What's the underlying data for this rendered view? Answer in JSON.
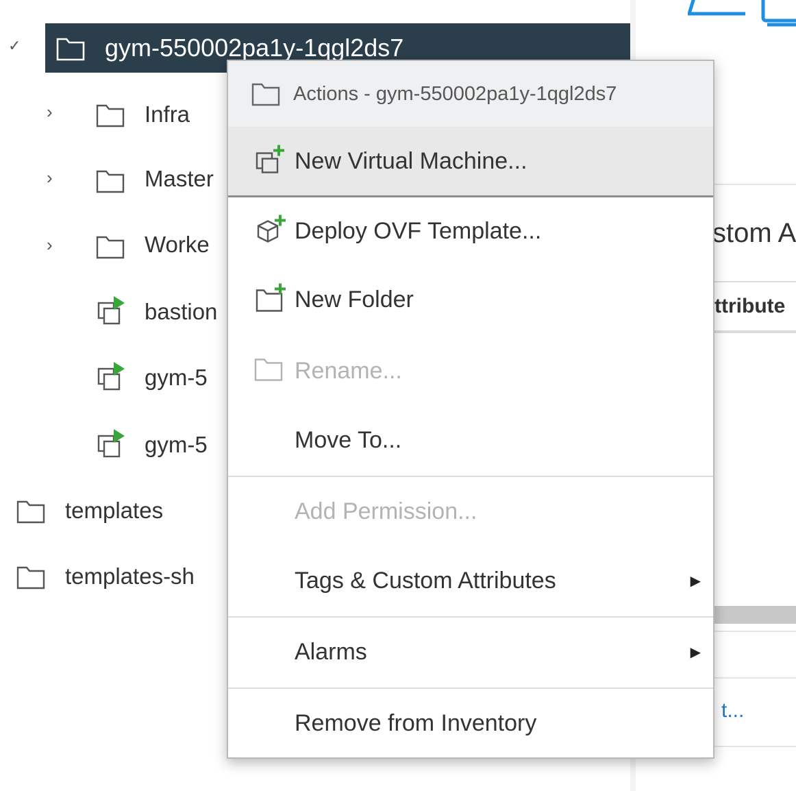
{
  "tree": {
    "root": {
      "label": "gym-550002pa1y-1qgl2ds7",
      "expanded": true
    },
    "children": [
      {
        "label": "Infra",
        "type": "folder"
      },
      {
        "label": "Master",
        "type": "folder"
      },
      {
        "label": "Worke",
        "type": "folder"
      },
      {
        "label": "bastion",
        "type": "vm"
      },
      {
        "label": "gym-5",
        "type": "vm"
      },
      {
        "label": "gym-5",
        "type": "vm"
      }
    ],
    "siblings": [
      {
        "label": "templates"
      },
      {
        "label": "templates-sh"
      }
    ]
  },
  "right_pane": {
    "fragment_heading": "stom A",
    "fragment_column": "ttribute",
    "fragment_link": "t..."
  },
  "context_menu": {
    "header": "Actions - gym-550002pa1y-1qgl2ds7",
    "items": [
      {
        "label": "New Virtual Machine...",
        "enabled": true,
        "hovered": true,
        "icon": "new-vm-icon"
      },
      {
        "label": "Deploy OVF Template...",
        "enabled": true,
        "icon": "deploy-ovf-icon"
      },
      {
        "label": "New Folder",
        "enabled": true,
        "icon": "new-folder-icon"
      },
      {
        "label": "Rename...",
        "enabled": false,
        "icon": "folder-icon"
      },
      {
        "label": "Move To...",
        "enabled": true
      },
      {
        "label": "Add Permission...",
        "enabled": false
      },
      {
        "label": "Tags & Custom Attributes",
        "enabled": true,
        "submenu": true
      },
      {
        "label": "Alarms",
        "enabled": true,
        "submenu": true
      },
      {
        "label": "Remove from Inventory",
        "enabled": true
      }
    ]
  },
  "colors": {
    "selected_row_bg": "#2b3e4c",
    "accent_green": "#3aa639",
    "link_blue": "#1f74c8"
  }
}
